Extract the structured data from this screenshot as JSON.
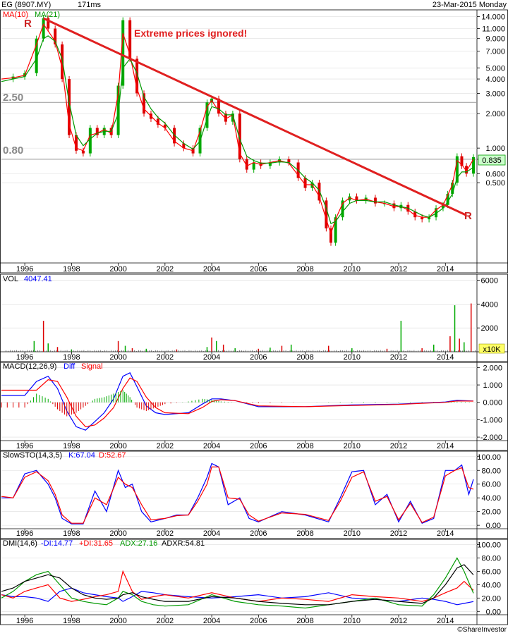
{
  "header": {
    "symbol": "EG (8907.MY)",
    "latency": "171ms",
    "date": "23-Mar-2015 Monday",
    "watermark": "©ShareInvestor"
  },
  "colors": {
    "price_up": "#00aa00",
    "price_down": "#dd0000",
    "ma10": "#ff0000",
    "ma21": "#009900",
    "trendline": "#e02020",
    "diff": "#0000ff",
    "signal": "#ff0000",
    "last_price_box": "#ccffcc",
    "volume_box": "#ffff66"
  },
  "annotations": {
    "headline": "Extreme prices ignored!",
    "resistance_left": "R",
    "resistance_right": "R",
    "level_high": "2.50",
    "level_low": "0.80"
  },
  "x_axis_labels": [
    "1996",
    "1998",
    "2000",
    "2002",
    "2004",
    "2006",
    "2008",
    "2010",
    "2012",
    "2014"
  ],
  "chart_data": [
    {
      "type": "line",
      "panel": "price",
      "scale": "log",
      "legend": [
        "MA(10)",
        "MA(21)"
      ],
      "last_price": "0.835",
      "y_ticks": [
        "14.000",
        "11.000",
        "9.000",
        "7.000",
        "5.000",
        "4.000",
        "3.000",
        "2.000",
        "1.000",
        "0.800",
        "0.600",
        "0.500"
      ],
      "y_tick_values": [
        14,
        11,
        9,
        7,
        5,
        4,
        3,
        2,
        1,
        0.8,
        0.6,
        0.5
      ],
      "ylim": [
        0.1,
        16
      ],
      "reference_levels": [
        2.5,
        0.8
      ],
      "trendline": {
        "x": [
          1996.8,
          2014.9
        ],
        "y": [
          13.5,
          0.26
        ]
      },
      "x": [
        1995.0,
        1995.5,
        1996.0,
        1996.5,
        1996.8,
        1997.0,
        1997.3,
        1997.6,
        1997.9,
        1998.2,
        1998.5,
        1998.8,
        1999.1,
        1999.4,
        1999.7,
        2000.0,
        2000.2,
        2000.5,
        2000.8,
        2001.1,
        2001.4,
        2001.7,
        2002.0,
        2002.4,
        2002.8,
        2003.2,
        2003.5,
        2003.8,
        2004.0,
        2004.3,
        2004.6,
        2004.9,
        2005.2,
        2005.5,
        2005.8,
        2006.1,
        2006.5,
        2006.9,
        2007.3,
        2007.7,
        2008.0,
        2008.3,
        2008.6,
        2008.9,
        2009.1,
        2009.3,
        2009.6,
        2009.9,
        2010.2,
        2010.6,
        2011.0,
        2011.4,
        2011.8,
        2012.1,
        2012.4,
        2012.7,
        2013.0,
        2013.3,
        2013.6,
        2013.9,
        2014.1,
        2014.3,
        2014.5,
        2014.7,
        2014.9,
        2015.2
      ],
      "series": [
        {
          "name": "Price",
          "values": [
            4.0,
            4.2,
            4.5,
            9.0,
            13.5,
            11.0,
            8.0,
            4.0,
            1.3,
            0.95,
            0.9,
            1.5,
            1.3,
            1.5,
            1.3,
            3.5,
            13.0,
            6.0,
            3.0,
            2.0,
            1.8,
            1.6,
            1.5,
            1.1,
            1.0,
            0.9,
            1.5,
            2.5,
            2.7,
            2.0,
            1.7,
            2.0,
            0.8,
            0.65,
            0.75,
            0.7,
            0.75,
            0.8,
            0.75,
            0.55,
            0.45,
            0.5,
            0.35,
            0.2,
            0.15,
            0.25,
            0.35,
            0.38,
            0.35,
            0.37,
            0.33,
            0.33,
            0.3,
            0.32,
            0.28,
            0.25,
            0.24,
            0.25,
            0.3,
            0.32,
            0.4,
            0.5,
            0.85,
            0.7,
            0.6,
            0.835
          ]
        },
        {
          "name": "MA(10)",
          "values": [
            4.0,
            4.1,
            4.3,
            8.0,
            12.0,
            10.5,
            8.5,
            5.0,
            1.6,
            1.0,
            0.95,
            1.3,
            1.35,
            1.45,
            1.35,
            3.0,
            10.0,
            6.5,
            3.3,
            2.2,
            1.9,
            1.65,
            1.5,
            1.15,
            1.0,
            0.95,
            1.4,
            2.3,
            2.6,
            2.1,
            1.8,
            1.95,
            0.9,
            0.7,
            0.75,
            0.72,
            0.75,
            0.78,
            0.74,
            0.58,
            0.48,
            0.48,
            0.38,
            0.24,
            0.18,
            0.24,
            0.33,
            0.37,
            0.35,
            0.36,
            0.34,
            0.33,
            0.31,
            0.31,
            0.29,
            0.26,
            0.25,
            0.25,
            0.29,
            0.32,
            0.39,
            0.48,
            0.78,
            0.72,
            0.63,
            0.8
          ]
        },
        {
          "name": "MA(21)",
          "values": [
            3.8,
            4.0,
            4.2,
            6.0,
            9.0,
            9.5,
            8.5,
            6.0,
            2.5,
            1.3,
            1.05,
            1.2,
            1.35,
            1.4,
            1.4,
            2.0,
            5.0,
            6.0,
            4.5,
            2.8,
            2.2,
            1.85,
            1.65,
            1.3,
            1.1,
            0.98,
            1.15,
            1.8,
            2.3,
            2.2,
            1.95,
            1.95,
            1.2,
            0.85,
            0.78,
            0.74,
            0.74,
            0.76,
            0.75,
            0.64,
            0.55,
            0.5,
            0.43,
            0.3,
            0.22,
            0.23,
            0.28,
            0.33,
            0.35,
            0.35,
            0.34,
            0.34,
            0.32,
            0.31,
            0.3,
            0.28,
            0.26,
            0.25,
            0.27,
            0.3,
            0.34,
            0.4,
            0.55,
            0.62,
            0.62,
            0.68
          ]
        }
      ]
    },
    {
      "type": "bar",
      "panel": "volume",
      "legend": "VOL",
      "legend_value": "4047.41",
      "unit": "x10K",
      "y_ticks": [
        "6000",
        "4000",
        "2000"
      ],
      "y_tick_values": [
        6000,
        4000,
        2000
      ],
      "ylim": [
        0,
        6500
      ],
      "x": [
        1996.4,
        1996.8,
        1997.0,
        1997.4,
        1998.0,
        2000.0,
        2000.3,
        2000.6,
        2001.2,
        2002.5,
        2003.8,
        2004.0,
        2004.2,
        2004.5,
        2005.0,
        2006.0,
        2006.5,
        2007.0,
        2007.4,
        2009.0,
        2010.0,
        2011.5,
        2012.1,
        2013.0,
        2013.5,
        2014.2,
        2014.4,
        2014.6,
        2014.8,
        2015.1
      ],
      "values": [
        900,
        2600,
        700,
        400,
        200,
        900,
        500,
        300,
        250,
        200,
        400,
        1200,
        900,
        600,
        300,
        250,
        350,
        500,
        600,
        500,
        300,
        250,
        2600,
        300,
        600,
        1300,
        3900,
        1100,
        800,
        4047
      ]
    },
    {
      "type": "line",
      "panel": "macd",
      "legend": [
        "MACD(12,26,9)",
        "Diff",
        "Signal"
      ],
      "y_ticks": [
        "2.000",
        "1.000",
        "0.000",
        "-1.000",
        "-2.000"
      ],
      "y_tick_values": [
        2,
        1,
        0,
        -1,
        -2
      ],
      "ylim": [
        -2.2,
        2.3
      ],
      "x": [
        1995.0,
        1996.0,
        1996.5,
        1997.0,
        1997.4,
        1997.8,
        1998.2,
        1998.6,
        1999.0,
        1999.4,
        1999.8,
        2000.2,
        2000.5,
        2000.8,
        2001.2,
        2001.6,
        2002.0,
        2003.0,
        2003.6,
        2004.0,
        2004.4,
        2005.0,
        2006.0,
        2008.0,
        2010.0,
        2012.0,
        2014.0,
        2014.5,
        2015.2
      ],
      "series": [
        {
          "name": "Diff",
          "values": [
            0.4,
            0.4,
            1.2,
            1.5,
            0.8,
            -0.5,
            -1.4,
            -1.6,
            -1.1,
            -0.6,
            0.2,
            1.5,
            1.7,
            0.9,
            -0.2,
            -0.6,
            -0.7,
            -0.6,
            -0.1,
            0.2,
            0.2,
            0.1,
            -0.25,
            -0.25,
            -0.15,
            -0.1,
            0.02,
            0.12,
            0.08
          ]
        },
        {
          "name": "Signal",
          "values": [
            0.7,
            0.7,
            0.7,
            1.3,
            1.2,
            0.3,
            -0.8,
            -1.4,
            -1.3,
            -0.9,
            -0.3,
            0.8,
            1.4,
            1.2,
            0.3,
            -0.3,
            -0.6,
            -0.65,
            -0.3,
            0.05,
            0.15,
            0.1,
            -0.2,
            -0.25,
            -0.18,
            -0.12,
            0.0,
            0.08,
            0.07
          ]
        }
      ]
    },
    {
      "type": "line",
      "panel": "stochastic",
      "legend": [
        "SlowSTO(14,3,5)",
        "K:67.04",
        "D:52.67"
      ],
      "y_ticks": [
        "100.00",
        "80.00",
        "60.00",
        "40.00",
        "20.00",
        "0.00"
      ],
      "y_tick_values": [
        100,
        80,
        60,
        40,
        20,
        0
      ],
      "ylim": [
        -5,
        108
      ],
      "x": [
        1995.0,
        1995.5,
        1996.0,
        1996.5,
        1997.0,
        1997.3,
        1997.6,
        1998.0,
        1998.5,
        1999.0,
        1999.5,
        2000.0,
        2000.3,
        2000.6,
        2001.0,
        2001.4,
        2002.0,
        2002.5,
        2003.0,
        2003.4,
        2003.8,
        2004.0,
        2004.3,
        2004.7,
        2005.2,
        2005.6,
        2006.0,
        2007.0,
        2008.0,
        2009.0,
        2009.5,
        2010.0,
        2010.5,
        2011.0,
        2011.5,
        2012.0,
        2012.5,
        2013.0,
        2013.5,
        2014.0,
        2014.4,
        2014.7,
        2015.0,
        2015.2
      ],
      "series": [
        {
          "name": "K",
          "values": [
            40,
            40,
            75,
            80,
            60,
            40,
            10,
            2,
            2,
            50,
            20,
            80,
            55,
            60,
            20,
            5,
            10,
            15,
            15,
            40,
            70,
            90,
            85,
            30,
            40,
            10,
            5,
            20,
            15,
            5,
            40,
            78,
            80,
            30,
            45,
            5,
            35,
            3,
            10,
            80,
            80,
            88,
            45,
            67
          ]
        },
        {
          "name": "D",
          "values": [
            42,
            40,
            70,
            78,
            65,
            45,
            15,
            3,
            3,
            40,
            30,
            70,
            60,
            55,
            30,
            8,
            10,
            14,
            15,
            35,
            60,
            85,
            85,
            40,
            38,
            15,
            6,
            18,
            16,
            7,
            35,
            70,
            78,
            35,
            42,
            8,
            32,
            4,
            12,
            72,
            80,
            84,
            55,
            52.67
          ]
        }
      ]
    },
    {
      "type": "line",
      "panel": "dmi",
      "legend": [
        "DMI(14,6)",
        "-DI:14.77",
        "+DI:31.65",
        "ADX:27.16",
        "ADXR:54.81"
      ],
      "y_ticks": [
        "100.00",
        "80.00",
        "60.00",
        "40.00",
        "20.00",
        "0.00"
      ],
      "y_tick_values": [
        100,
        80,
        60,
        40,
        20,
        0
      ],
      "ylim": [
        -5,
        108
      ],
      "x": [
        1995.0,
        1995.5,
        1996.0,
        1996.5,
        1997.0,
        1997.5,
        1998.0,
        1998.5,
        1999.0,
        1999.5,
        2000.0,
        2000.2,
        2000.6,
        2001.0,
        2001.5,
        2002.0,
        2003.0,
        2004.0,
        2005.0,
        2006.0,
        2007.0,
        2008.0,
        2009.0,
        2010.0,
        2011.0,
        2012.0,
        2013.0,
        2013.5,
        2014.0,
        2014.5,
        2014.8,
        2015.2
      ],
      "series": [
        {
          "name": "-DI",
          "values": [
            25,
            22,
            22,
            20,
            15,
            30,
            35,
            28,
            25,
            22,
            20,
            15,
            22,
            30,
            28,
            25,
            22,
            20,
            22,
            25,
            20,
            22,
            28,
            20,
            18,
            15,
            20,
            18,
            15,
            10,
            12,
            14.77
          ]
        },
        {
          "name": "+DI",
          "values": [
            25,
            20,
            30,
            35,
            40,
            20,
            15,
            18,
            22,
            25,
            30,
            60,
            30,
            18,
            22,
            25,
            20,
            28,
            20,
            15,
            20,
            18,
            15,
            25,
            22,
            20,
            15,
            20,
            28,
            35,
            45,
            31.65
          ]
        },
        {
          "name": "ADX",
          "values": [
            20,
            30,
            45,
            55,
            60,
            40,
            20,
            15,
            12,
            10,
            20,
            30,
            25,
            15,
            10,
            8,
            10,
            25,
            15,
            10,
            8,
            5,
            10,
            15,
            20,
            10,
            8,
            25,
            50,
            80,
            60,
            27.16
          ]
        },
        {
          "name": "ADXR",
          "values": [
            30,
            35,
            45,
            50,
            55,
            50,
            35,
            25,
            20,
            18,
            20,
            25,
            28,
            22,
            18,
            15,
            15,
            22,
            20,
            15,
            12,
            10,
            10,
            15,
            18,
            15,
            12,
            20,
            40,
            65,
            70,
            54.81
          ]
        }
      ]
    }
  ]
}
